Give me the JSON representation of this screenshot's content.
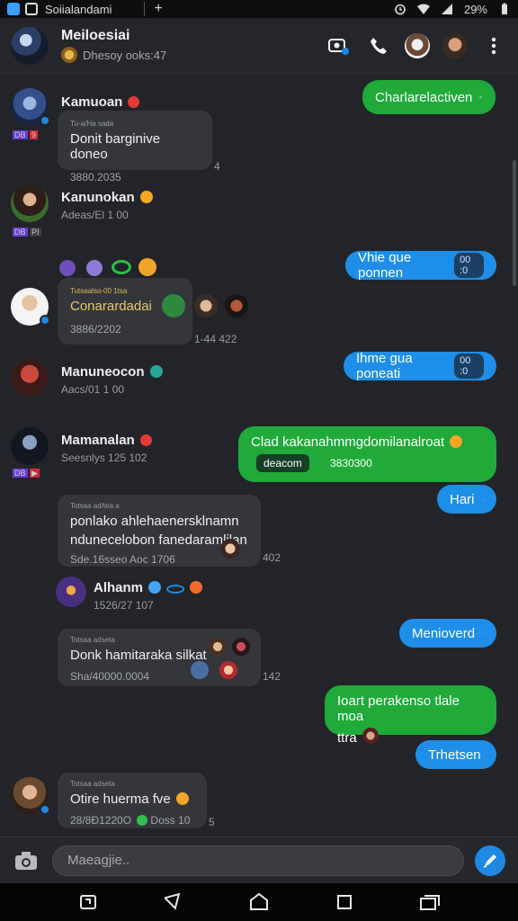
{
  "status_bar": {
    "app_title": "Soiialandami",
    "new_tab": "+",
    "battery": "29%",
    "icons": [
      "alarm-icon",
      "wifi-icon",
      "signal-icon",
      "battery-icon"
    ]
  },
  "header": {
    "title": "Meiloesiai",
    "subtitle": "Dhesoy ooks:47",
    "actions": [
      "video-call-icon",
      "phone-icon",
      "contact-avatar-1",
      "contact-avatar-2",
      "more-vert-icon"
    ]
  },
  "messages": {
    "m1": {
      "name": "Kamuoan",
      "bubble_head": "Tu-a/Ha sada",
      "text": "Donit barginive doneo",
      "time": "3880.2035",
      "side": "4"
    },
    "o1": {
      "text": "Charlarelactiven"
    },
    "m2": {
      "name": "Kanunokan",
      "time": "Adeas/El 1 00"
    },
    "o2": {
      "text": "Vhie que ponnen",
      "pill": "00 :0"
    },
    "m3": {
      "bubble_head": "Tutsaalso-00 1tsa",
      "text": "Conarardadai",
      "time": "3886/2202",
      "side": "1-44 422"
    },
    "m4": {
      "name": "Manuneocon",
      "time": "Aacs/01 1 00"
    },
    "o3": {
      "text": "Ihme gua poneati",
      "pill": "00 :0"
    },
    "m5": {
      "name": "Mamanalan",
      "time": "Seesnlys 125 102"
    },
    "o4": {
      "text": "Clad kakanahmmgdomilanalroat",
      "sub": "deacom",
      "time": "3830300"
    },
    "o5": {
      "text": "Hari"
    },
    "m6": {
      "bubble_head": "Totsaa ad/tea a",
      "line1": "ponlako ahlehaenersklnamn",
      "line2": "ndunecelobon fanedaramlilan",
      "time": "Sde.16sseo Aoc 1706",
      "side": "402"
    },
    "m7": {
      "name": "Alhanm",
      "time": "1526/27 107"
    },
    "o6": {
      "text": "Menioverd"
    },
    "m8": {
      "bubble_head": "Totsaa adseta",
      "text": "Donk hamitaraka silkat",
      "time": "Sha/40000.0004",
      "side": "142"
    },
    "o7": {
      "line1": "Ioart perakenso tlale moa",
      "line2": "ttra"
    },
    "o8": {
      "text": "Trhetsen"
    },
    "m9": {
      "bubble_head": "Totsaa adseta",
      "text": "Otire huerma fve",
      "time": "28/8Ð1220O",
      "extra": "Doss 10",
      "side": "5"
    }
  },
  "composer": {
    "placeholder": "Maeagjie.."
  },
  "navbar": [
    "recent-apps-icon",
    "back-icon",
    "home-icon",
    "overview-icon",
    "multiwindow-icon"
  ],
  "colors": {
    "green": "#1faa3a",
    "blue": "#1e8ee8",
    "bg": "#222429",
    "bubble": "#34363c"
  }
}
